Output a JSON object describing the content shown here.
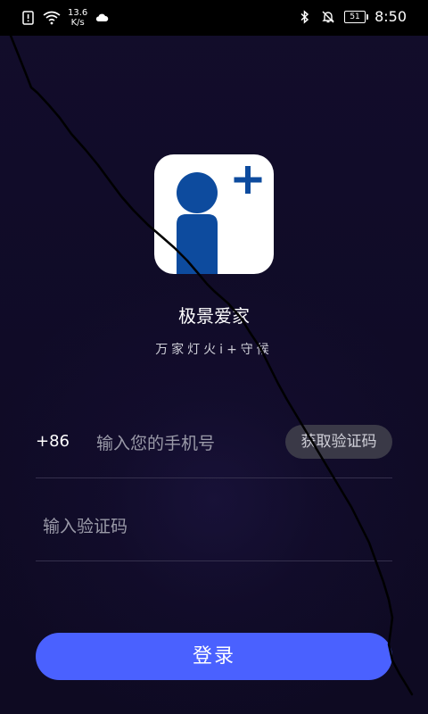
{
  "status_bar": {
    "net_speed_value": "13.6",
    "net_speed_unit": "K/s",
    "battery_level": "51",
    "time": "8:50"
  },
  "app": {
    "name": "极景爱家",
    "slogan": "万家灯火i+守候"
  },
  "login_form": {
    "country_code": "+86",
    "phone_placeholder": "输入您的手机号",
    "get_code_label": "获取验证码",
    "code_placeholder": "输入验证码",
    "login_label": "登录"
  },
  "colors": {
    "background": "#0f0b24",
    "accent": "#4a61ff",
    "logo_blue": "#0d4b9e",
    "secondary_button": "#3a3947"
  },
  "icons": {
    "status_left": [
      "alert-icon",
      "wifi-icon",
      "cloud-icon"
    ],
    "status_right": [
      "bluetooth-icon",
      "mute-icon",
      "battery-icon"
    ]
  }
}
